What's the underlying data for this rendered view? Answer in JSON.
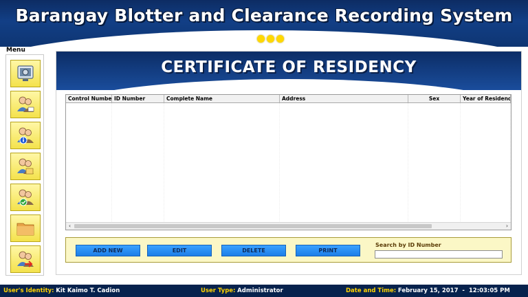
{
  "header": {
    "title": "Barangay Blotter and Clearance Recording System",
    "dots": 3,
    "dot_color": "#ffd800"
  },
  "sidebar": {
    "label": "Menu",
    "items": [
      {
        "icon": "monitor-settings-icon"
      },
      {
        "icon": "users-edit-icon"
      },
      {
        "icon": "users-info-icon"
      },
      {
        "icon": "users-document-icon"
      },
      {
        "icon": "users-check-icon"
      },
      {
        "icon": "folder-icon"
      },
      {
        "icon": "users-logout-icon"
      }
    ]
  },
  "main": {
    "title": "CERTIFICATE OF RESIDENCY",
    "table": {
      "columns": [
        "Control Number",
        "ID Number",
        "Complete Name",
        "Address",
        "Sex",
        "Year of Residency"
      ],
      "rows": []
    },
    "actions": {
      "add_new": "ADD NEW",
      "edit": "EDIT",
      "delete": "DELETE",
      "print": "PRINT"
    },
    "search": {
      "label": "Search by ID Number",
      "value": ""
    }
  },
  "status": {
    "identity_label": "User's Identity:",
    "identity_value": "Kit Kaimo T. Cadion",
    "usertype_label": "User Type:",
    "usertype_value": "Administrator",
    "datetime_label": "Date and Time:",
    "datetime_value": "February 15, 2017  -  12:03:05 PM"
  },
  "colors": {
    "banner": "#123f86",
    "accent_yellow": "#f4e24c",
    "button_blue": "#1c7ee8",
    "status_bar": "#07224d"
  }
}
